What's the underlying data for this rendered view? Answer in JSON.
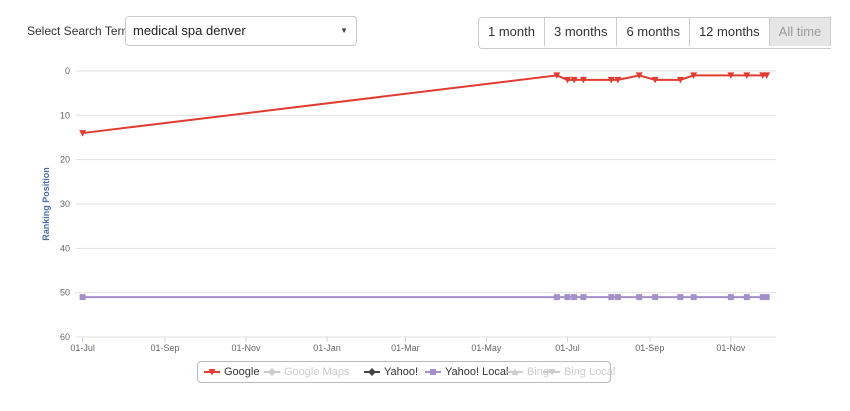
{
  "search": {
    "label": "Select Search Term:",
    "selected": "medical spa denver"
  },
  "range_buttons": [
    "1 month",
    "3 months",
    "6 months",
    "12 months",
    "All time"
  ],
  "chart_data": {
    "type": "line",
    "ylabel": "Ranking Position",
    "ylim": [
      0,
      60
    ],
    "y_reversed": true,
    "y_ticks": [
      0,
      10,
      20,
      30,
      40,
      50,
      60
    ],
    "x_ticks": [
      "01-Jul",
      "01-Sep",
      "01-Nov",
      "01-Jan",
      "01-Mar",
      "01-May",
      "01-Jul",
      "01-Sep",
      "01-Nov"
    ],
    "grid": true,
    "legend_position": "bottom",
    "series": [
      {
        "name": "Google",
        "color": "#e03c31",
        "marker": "triangle-down",
        "points": [
          [
            "2016-07-01",
            14
          ],
          [
            "2017-06-23",
            1
          ],
          [
            "2017-07-01",
            2
          ],
          [
            "2017-07-06",
            2
          ],
          [
            "2017-07-13",
            2
          ],
          [
            "2017-08-03",
            2
          ],
          [
            "2017-08-08",
            2
          ],
          [
            "2017-08-24",
            1
          ],
          [
            "2017-09-05",
            2
          ],
          [
            "2017-09-24",
            2
          ],
          [
            "2017-10-04",
            1
          ],
          [
            "2017-11-01",
            1
          ],
          [
            "2017-11-13",
            1
          ],
          [
            "2017-11-25",
            1
          ],
          [
            "2017-11-28",
            1
          ]
        ]
      },
      {
        "name": "Google Maps",
        "color": "#cccccc",
        "marker": "diamond",
        "hidden": true,
        "points": []
      },
      {
        "name": "Yahoo!",
        "color": "#434348",
        "marker": "diamond",
        "points": []
      },
      {
        "name": "Yahoo! Local",
        "color": "#a58fc9",
        "marker": "square",
        "points": [
          [
            "2016-07-01",
            51
          ],
          [
            "2017-06-23",
            51
          ],
          [
            "2017-07-01",
            51
          ],
          [
            "2017-07-06",
            51
          ],
          [
            "2017-07-13",
            51
          ],
          [
            "2017-08-03",
            51
          ],
          [
            "2017-08-08",
            51
          ],
          [
            "2017-08-24",
            51
          ],
          [
            "2017-09-05",
            51
          ],
          [
            "2017-09-24",
            51
          ],
          [
            "2017-10-04",
            51
          ],
          [
            "2017-11-01",
            51
          ],
          [
            "2017-11-13",
            51
          ],
          [
            "2017-11-25",
            51
          ],
          [
            "2017-11-28",
            51
          ]
        ]
      },
      {
        "name": "Bing",
        "color": "#cccccc",
        "marker": "triangle",
        "hidden": true,
        "points": []
      },
      {
        "name": "Bing Local",
        "color": "#cccccc",
        "marker": "triangle-down",
        "hidden": true,
        "points": []
      }
    ]
  }
}
